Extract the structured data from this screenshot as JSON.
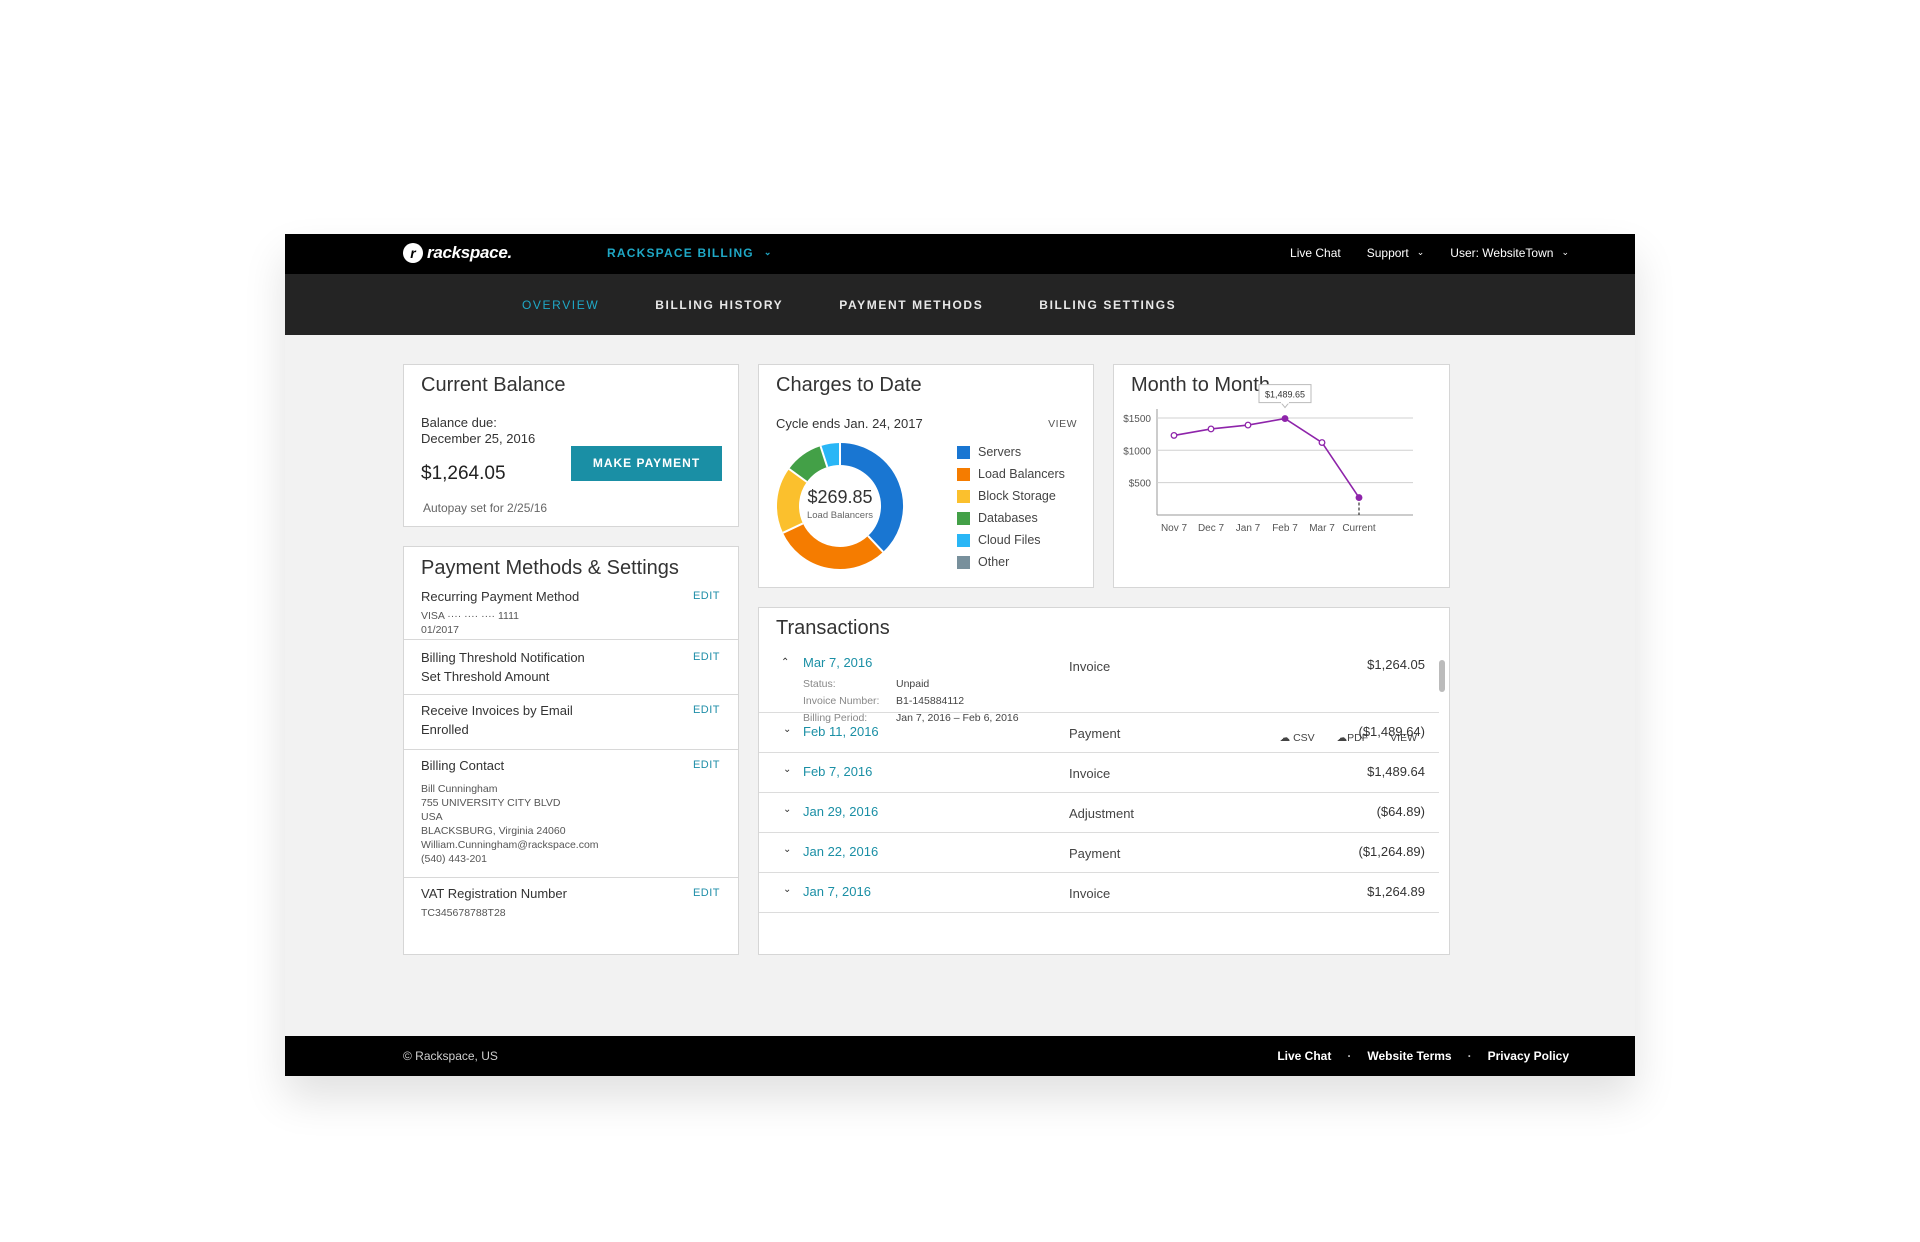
{
  "brand": {
    "name": "rackspace."
  },
  "topbar": {
    "app_switch": "RACKSPACE BILLING",
    "live_chat": "Live Chat",
    "support": "Support",
    "user": "User: WebsiteTown"
  },
  "nav": {
    "tabs": [
      "OVERVIEW",
      "BILLING HISTORY",
      "PAYMENT METHODS",
      "BILLING SETTINGS"
    ]
  },
  "current_balance": {
    "title": "Current Balance",
    "due_label": "Balance due:",
    "due_date": "December 25, 2016",
    "amount": "$1,264.05",
    "autopay": "Autopay set for 2/25/16",
    "button": "MAKE PAYMENT"
  },
  "payment_methods": {
    "title": "Payment Methods & Settings",
    "edit_label": "EDIT",
    "recurring": {
      "label": "Recurring Payment Method",
      "card": "VISA     ····  ····  ····  1111",
      "expiry": "01/2017"
    },
    "threshold": {
      "label": "Billing Threshold Notification",
      "value": "Set Threshold Amount"
    },
    "invoices": {
      "label": "Receive Invoices by Email",
      "value": "Enrolled"
    },
    "contact": {
      "label": "Billing Contact",
      "lines": [
        "Bill Cunningham",
        "755 UNIVERSITY CITY BLVD",
        "USA",
        "BLACKSBURG, Virginia 24060",
        "William.Cunningham@rackspace.com",
        "(540) 443-201"
      ]
    },
    "vat": {
      "label": "VAT Registration Number",
      "value": "TC345678788T28"
    }
  },
  "charges": {
    "title": "Charges to Date",
    "cycle": "Cycle ends Jan. 24, 2017",
    "view": "VIEW",
    "center_amount": "$269.85",
    "center_label": "Load Balancers",
    "legend": [
      {
        "name": "Servers",
        "color": "#1976d2",
        "share": 0.38
      },
      {
        "name": "Load Balancers",
        "color": "#f57c00",
        "share": 0.3
      },
      {
        "name": "Block Storage",
        "color": "#fbc02d",
        "share": 0.17
      },
      {
        "name": "Databases",
        "color": "#43a047",
        "share": 0.1
      },
      {
        "name": "Cloud Files",
        "color": "#29b6f6",
        "share": 0.05
      },
      {
        "name": "Other",
        "color": "#78909c",
        "share": 0
      }
    ]
  },
  "month_to_month": {
    "title": "Month to Month",
    "tooltip": "$1,489.65",
    "y_ticks": [
      "$1500",
      "$1000",
      "$500"
    ],
    "x_ticks": [
      "Nov 7",
      "Dec 7",
      "Jan 7",
      "Feb 7",
      "Mar 7",
      "Current"
    ],
    "series_color": "#8e24aa"
  },
  "chart_data": {
    "type": "line",
    "title": "Month to Month",
    "categories": [
      "Nov 7",
      "Dec 7",
      "Jan 7",
      "Feb 7",
      "Mar 7",
      "Current"
    ],
    "values": [
      1230,
      1330,
      1390,
      1489.65,
      1120,
      270
    ],
    "ylim": [
      0,
      1700
    ],
    "y_ticks": [
      500,
      1000,
      1500
    ],
    "grid": true
  },
  "transactions": {
    "title": "Transactions",
    "expanded": {
      "date": "Mar 7, 2016",
      "type": "Invoice",
      "amount": "$1,264.05",
      "status_label": "Status:",
      "status": "Unpaid",
      "number_label": "Invoice Number:",
      "number": "B1-145884112",
      "period_label": "Billing Period:",
      "period": "Jan 7, 2016 –   Feb 6, 2016",
      "csv": "CSV",
      "pdf": "PDF",
      "view": "VIEW"
    },
    "rows": [
      {
        "date": "Feb 11, 2016",
        "type": "Payment",
        "amount": "($1,489.64)"
      },
      {
        "date": "Feb 7, 2016",
        "type": "Invoice",
        "amount": "$1,489.64"
      },
      {
        "date": "Jan 29, 2016",
        "type": "Adjustment",
        "amount": "($64.89)"
      },
      {
        "date": "Jan 22, 2016",
        "type": "Payment",
        "amount": "($1,264.89)"
      },
      {
        "date": "Jan 7, 2016",
        "type": "Invoice",
        "amount": "$1,264.89"
      }
    ]
  },
  "footer": {
    "copyright": "© Rackspace, US",
    "links": [
      "Live Chat",
      "Website Terms",
      "Privacy Policy"
    ]
  }
}
